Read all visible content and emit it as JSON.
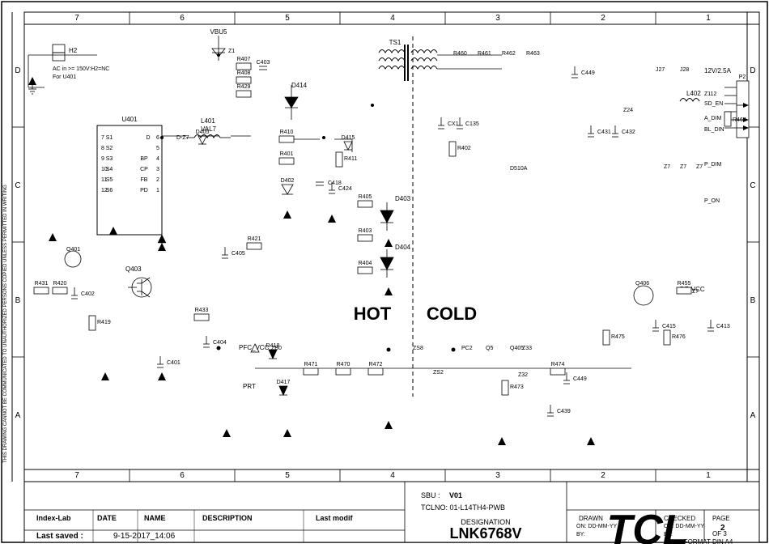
{
  "title": "TCL",
  "designation": "LNK6768V",
  "designation_label": "DESIGNATION",
  "sbu": "V01",
  "tclno": "01-L14TH4-PWB",
  "sbu_label": "SBU :",
  "tclno_label": "TCLNO:",
  "page": "2",
  "of": "3",
  "page_label": "PAGE",
  "of_label": "OF",
  "format": "FORMAT DIN A4",
  "drawn_on": "DD-MM-YY",
  "checked_on": "DD-MM-YY",
  "drawn_label": "DRAWN ON",
  "checked_label": "CHECKED ON",
  "by_label": "BY:",
  "last_saved": "Last saved :",
  "last_saved_date": "9-15-2017_14:06",
  "index_lab": "Index-Lab",
  "date_col": "DATE",
  "name_col": "NAME",
  "description_col": "DESCRIPTION",
  "last_modif": "Last modif",
  "hot_label": "HOT",
  "cold_label": "COLD",
  "grid_numbers": [
    "7",
    "6",
    "5",
    "4",
    "3",
    "2",
    "1"
  ],
  "grid_letters": [
    "D",
    "C",
    "B",
    "A"
  ],
  "components": {
    "u401": "U401",
    "q403": "Q403",
    "q401": "Q401",
    "q406": "Q406",
    "l401": "L401",
    "l402": "L402",
    "d414": "D414",
    "d403": "D403",
    "d404": "D404",
    "d417": "D417",
    "d418": "D418",
    "ts1": "TS1",
    "vbus": "VBU5",
    "h2": "H2",
    "ac_in": "AC in >= 150V:H2=NC",
    "for_u401": "For U401",
    "val7": "VAL7",
    "pfc_vcc": "PFC_VCC",
    "prt": "PRT",
    "dr_vcc": "DR VCC",
    "volt": "12V/2.5A",
    "p2": "P2",
    "r464": "R464",
    "r475": "R475",
    "r476": "R476",
    "s1": "S1",
    "s2": "S2",
    "s3": "S3",
    "s4": "S4",
    "s5": "S5",
    "s6": "S6",
    "sd_en": "SD_EN",
    "a_dim": "A_DIM",
    "bl_din": "BL_DIN",
    "p_dim": "P_DIM",
    "p_on": "P_ON"
  },
  "warning_text": "THIS DRAWING CANNOT BE COMMUNICATED TO UNAUTHORIZED PERSONS COPIED UNLESS PERMITTED IN WRITING"
}
